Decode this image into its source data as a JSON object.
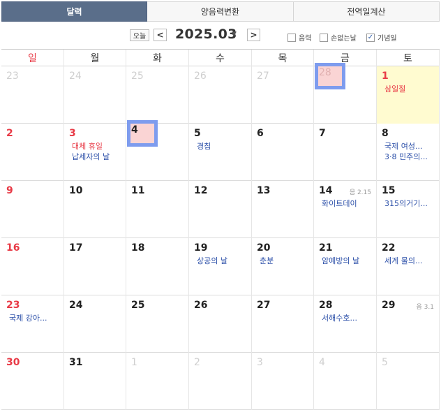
{
  "tabs": [
    {
      "label": "달력",
      "active": true
    },
    {
      "label": "양음력변환",
      "active": false
    },
    {
      "label": "전역일계산",
      "active": false
    }
  ],
  "toolbar": {
    "today_label": "오늘",
    "prev_label": "<",
    "next_label": ">",
    "title": "2025.03",
    "options": [
      {
        "label": "음력",
        "checked": false
      },
      {
        "label": "손없는날",
        "checked": false
      },
      {
        "label": "기념일",
        "checked": true
      }
    ]
  },
  "weekdays": [
    "일",
    "월",
    "화",
    "수",
    "목",
    "금",
    "토"
  ],
  "weeks": [
    [
      {
        "num": "23",
        "dim": true
      },
      {
        "num": "24",
        "dim": true
      },
      {
        "num": "25",
        "dim": true
      },
      {
        "num": "26",
        "dim": true
      },
      {
        "num": "27",
        "dim": true
      },
      {
        "num": "28",
        "dim": true,
        "marked": true
      },
      {
        "num": "1",
        "red": true,
        "highlight": true,
        "events": [
          {
            "text": "삼일절",
            "red": true
          }
        ]
      }
    ],
    [
      {
        "num": "2",
        "red": true
      },
      {
        "num": "3",
        "red": true,
        "events": [
          {
            "text": "대체 휴일",
            "red": true
          },
          {
            "text": "납세자의 날"
          }
        ]
      },
      {
        "num": "4",
        "marked": true
      },
      {
        "num": "5",
        "events": [
          {
            "text": "경칩"
          }
        ]
      },
      {
        "num": "6"
      },
      {
        "num": "7"
      },
      {
        "num": "8",
        "events": [
          {
            "text": "국제 여성..."
          },
          {
            "text": "3·8 민주의..."
          }
        ]
      }
    ],
    [
      {
        "num": "9",
        "red": true
      },
      {
        "num": "10"
      },
      {
        "num": "11"
      },
      {
        "num": "12"
      },
      {
        "num": "13"
      },
      {
        "num": "14",
        "lunar": "음 2.15",
        "events": [
          {
            "text": "화이트데이"
          }
        ]
      },
      {
        "num": "15",
        "events": [
          {
            "text": "315의거기..."
          }
        ]
      }
    ],
    [
      {
        "num": "16",
        "red": true
      },
      {
        "num": "17"
      },
      {
        "num": "18"
      },
      {
        "num": "19",
        "events": [
          {
            "text": "상공의 날"
          }
        ]
      },
      {
        "num": "20",
        "events": [
          {
            "text": "춘분"
          }
        ]
      },
      {
        "num": "21",
        "events": [
          {
            "text": "암예방의 날"
          }
        ]
      },
      {
        "num": "22",
        "events": [
          {
            "text": "세계 물의..."
          }
        ]
      }
    ],
    [
      {
        "num": "23",
        "red": true,
        "events": [
          {
            "text": "국제 강아..."
          }
        ]
      },
      {
        "num": "24"
      },
      {
        "num": "25"
      },
      {
        "num": "26"
      },
      {
        "num": "27"
      },
      {
        "num": "28",
        "events": [
          {
            "text": "서해수호..."
          }
        ]
      },
      {
        "num": "29",
        "lunar": "음 3.1"
      }
    ],
    [
      {
        "num": "30",
        "red": true
      },
      {
        "num": "31"
      },
      {
        "num": "1",
        "dim": true
      },
      {
        "num": "2",
        "dim": true
      },
      {
        "num": "3",
        "dim": true
      },
      {
        "num": "4",
        "dim": true
      },
      {
        "num": "5",
        "dim": true
      }
    ]
  ],
  "colors": {
    "tab_active_bg": "#5a6e8a",
    "holiday_red": "#e83a46",
    "event_blue": "#2a4ea8",
    "highlight_yellow": "#fffbd0",
    "mark_border": "#7e9cee",
    "mark_fill": "#fad4d4"
  }
}
